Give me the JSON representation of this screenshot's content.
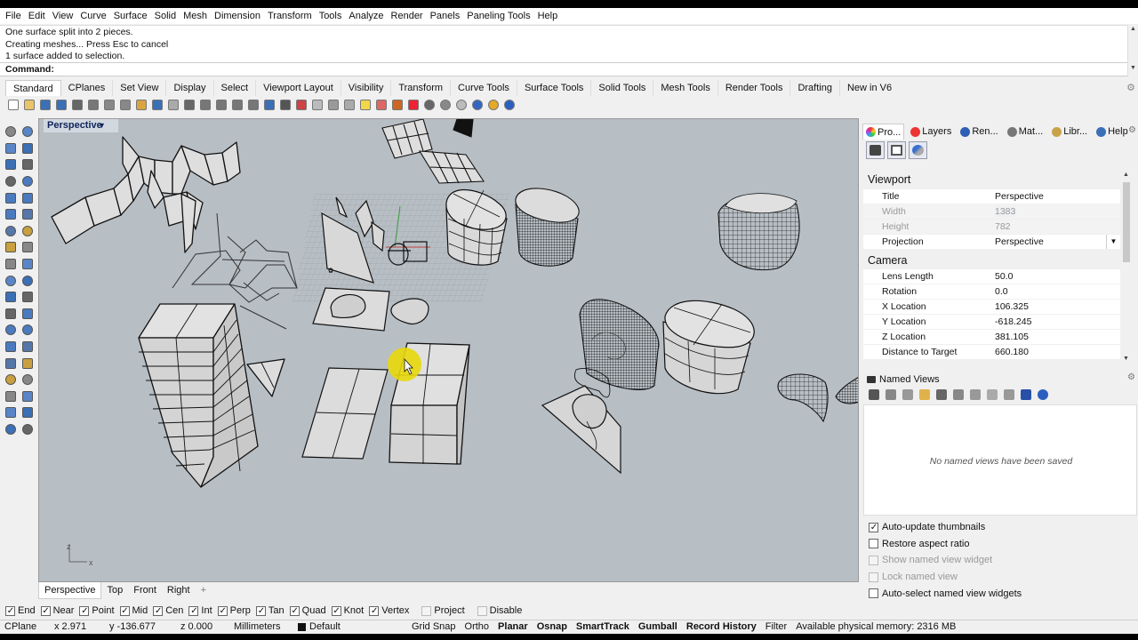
{
  "menubar": [
    "File",
    "Edit",
    "View",
    "Curve",
    "Surface",
    "Solid",
    "Mesh",
    "Dimension",
    "Transform",
    "Tools",
    "Analyze",
    "Render",
    "Panels",
    "Paneling Tools",
    "Help"
  ],
  "command_history": [
    "One surface split into 2 pieces.",
    "Creating meshes... Press Esc to cancel",
    "1 surface added to selection."
  ],
  "command_prompt": "Command:",
  "toolbar_tabs": [
    "Standard",
    "CPlanes",
    "Set View",
    "Display",
    "Select",
    "Viewport Layout",
    "Visibility",
    "Transform",
    "Curve Tools",
    "Surface Tools",
    "Solid Tools",
    "Mesh Tools",
    "Render Tools",
    "Drafting",
    "New in V6"
  ],
  "active_toolbar_tab": "Standard",
  "viewport": {
    "title": "Perspective",
    "axis_z": "z",
    "axis_x": "x"
  },
  "viewport_tabs": [
    "Perspective",
    "Top",
    "Front",
    "Right"
  ],
  "viewport_add": "+",
  "osnaps": [
    {
      "label": "End",
      "checked": true
    },
    {
      "label": "Near",
      "checked": true
    },
    {
      "label": "Point",
      "checked": true
    },
    {
      "label": "Mid",
      "checked": true
    },
    {
      "label": "Cen",
      "checked": true
    },
    {
      "label": "Int",
      "checked": true
    },
    {
      "label": "Perp",
      "checked": true
    },
    {
      "label": "Tan",
      "checked": true
    },
    {
      "label": "Quad",
      "checked": true
    },
    {
      "label": "Knot",
      "checked": true
    },
    {
      "label": "Vertex",
      "checked": true
    },
    {
      "label": "Project",
      "checked": false
    },
    {
      "label": "Disable",
      "checked": false
    }
  ],
  "status": {
    "cplane": "CPlane",
    "x": "x 2.971",
    "y": "y -136.677",
    "z": "z 0.000",
    "units": "Millimeters",
    "layer": "Default",
    "grid_snap": "Grid Snap",
    "ortho": "Ortho",
    "planar": "Planar",
    "osnap": "Osnap",
    "smarttrack": "SmartTrack",
    "gumball": "Gumball",
    "record_history": "Record History",
    "filter": "Filter",
    "memory": "Available physical memory: 2316 MB"
  },
  "panel_tabs": [
    "Pro...",
    "Layers",
    "Ren...",
    "Mat...",
    "Libr...",
    "Help"
  ],
  "properties": {
    "viewport_section": "Viewport",
    "viewport_rows": [
      {
        "key": "Title",
        "value": "Perspective"
      },
      {
        "key": "Width",
        "value": "1383"
      },
      {
        "key": "Height",
        "value": "782"
      },
      {
        "key": "Projection",
        "value": "Perspective"
      }
    ],
    "camera_section": "Camera",
    "camera_rows": [
      {
        "key": "Lens Length",
        "value": "50.0"
      },
      {
        "key": "Rotation",
        "value": "0.0"
      },
      {
        "key": "X Location",
        "value": "106.325"
      },
      {
        "key": "Y Location",
        "value": "-618.245"
      },
      {
        "key": "Z Location",
        "value": "381.105"
      },
      {
        "key": "Distance to Target",
        "value": "660.180"
      }
    ]
  },
  "named_views": {
    "title": "Named Views",
    "empty_message": "No named views have been saved",
    "options": [
      {
        "label": "Auto-update thumbnails",
        "checked": true,
        "enabled": true
      },
      {
        "label": "Restore aspect ratio",
        "checked": false,
        "enabled": true
      },
      {
        "label": "Show named view widget",
        "checked": false,
        "enabled": false
      },
      {
        "label": "Lock named view",
        "checked": false,
        "enabled": false
      },
      {
        "label": "Auto-select named view widgets",
        "checked": false,
        "enabled": true
      }
    ]
  },
  "colors": {
    "viewport_bg": "#b7bec4",
    "title_text": "#10245a",
    "cursor_highlight": "#e8d80a"
  }
}
